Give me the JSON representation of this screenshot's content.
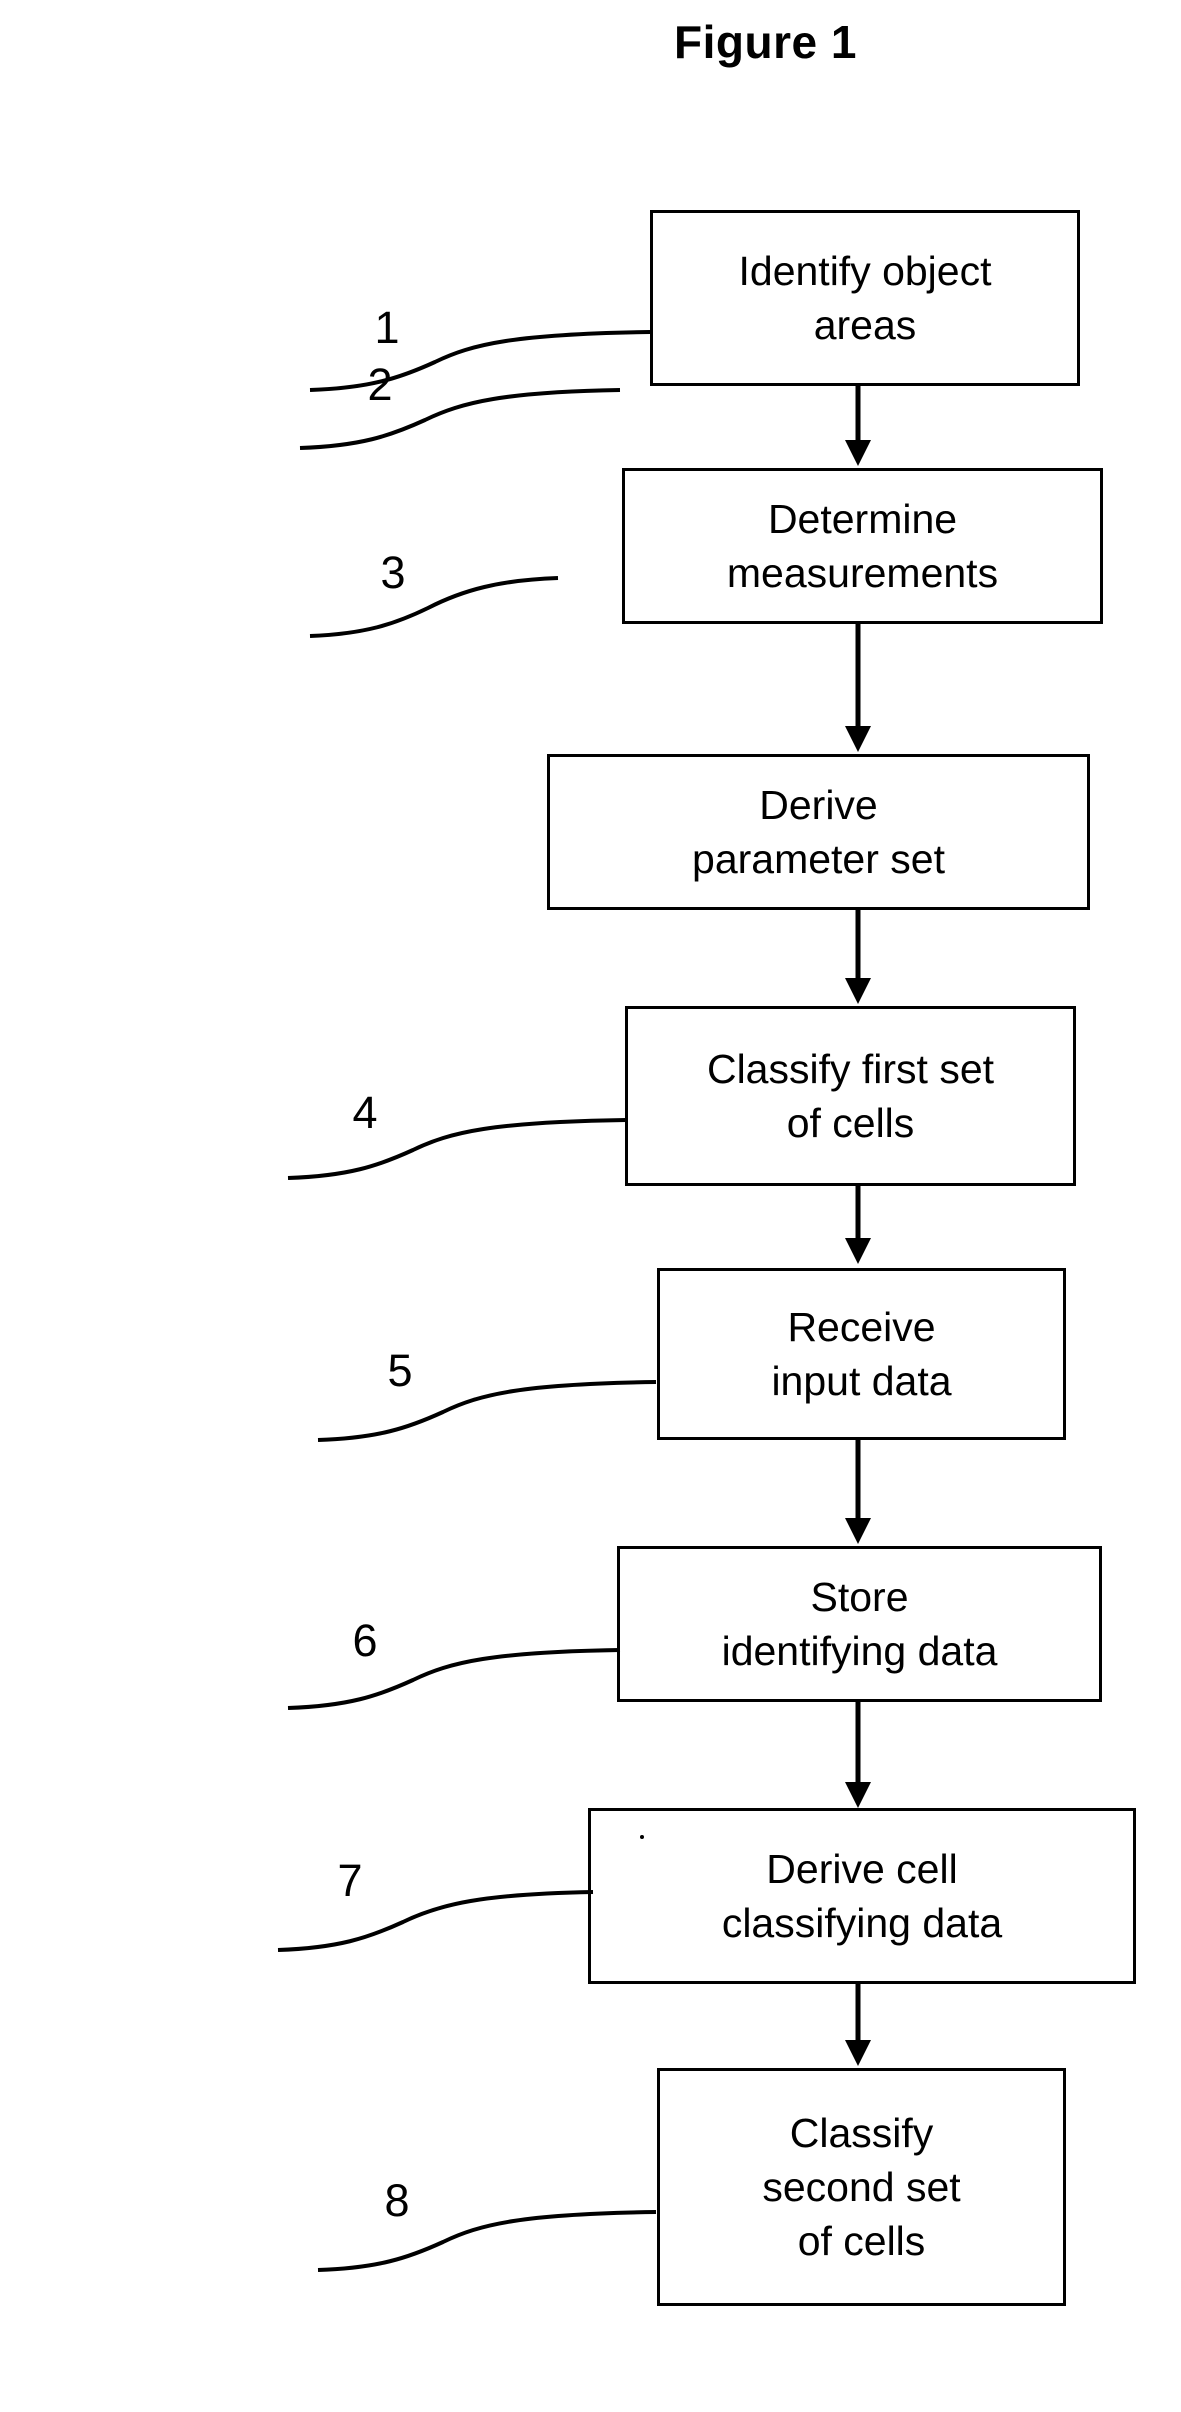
{
  "figure": {
    "title": "Figure 1",
    "type": "flowchart",
    "orientation": "vertical",
    "background_color": "#ffffff",
    "line_color": "#000000"
  },
  "steps": [
    {
      "ref": "1",
      "label": "Identify object\nareas",
      "line1": "Identify object",
      "line2": "areas"
    },
    {
      "ref": "2",
      "label": "Determine\nmeasurements",
      "line1": "Determine",
      "line2": "measurements"
    },
    {
      "ref": "3",
      "label": "Derive\nparameter set",
      "line1": "Derive",
      "line2": "parameter set"
    },
    {
      "ref": "4",
      "label": "Classify first set\nof cells",
      "line1": "Classify first set",
      "line2": "of cells"
    },
    {
      "ref": "5",
      "label": "Receive\ninput data",
      "line1": "Receive",
      "line2": "input data"
    },
    {
      "ref": "6",
      "label": "Store\nidentifying data",
      "line1": "Store",
      "line2": "identifying data"
    },
    {
      "ref": "7",
      "label": "Derive cell\nclassifying data",
      "line1": "Derive cell",
      "line2": "classifying data"
    },
    {
      "ref": "8",
      "label": "Classify\nsecond set\nof cells",
      "line1": "Classify",
      "line2": "second set",
      "line3": "of cells"
    }
  ]
}
